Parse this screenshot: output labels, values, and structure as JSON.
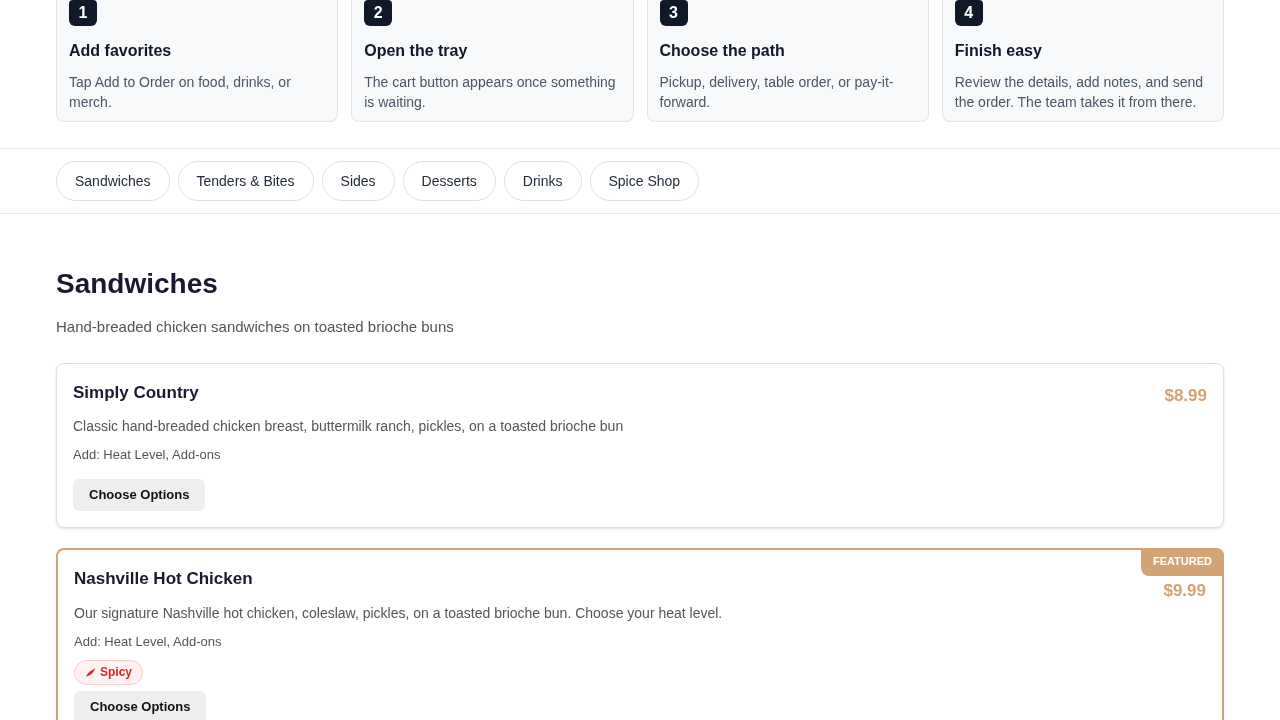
{
  "steps": [
    {
      "number": "1",
      "title": "Add favorites",
      "text": "Tap Add to Order on food, drinks, or merch."
    },
    {
      "number": "2",
      "title": "Open the tray",
      "text": "The cart button appears once something is waiting."
    },
    {
      "number": "3",
      "title": "Choose the path",
      "text": "Pickup, delivery, table order, or pay-it-forward."
    },
    {
      "number": "4",
      "title": "Finish easy",
      "text": "Review the details, add notes, and send the order. The team takes it from there."
    }
  ],
  "categories": [
    {
      "label": "Sandwiches"
    },
    {
      "label": "Tenders & Bites"
    },
    {
      "label": "Sides"
    },
    {
      "label": "Desserts"
    },
    {
      "label": "Drinks"
    },
    {
      "label": "Spice Shop"
    }
  ],
  "section": {
    "title": "Sandwiches",
    "subtitle": "Hand-breaded chicken sandwiches on toasted brioche buns"
  },
  "items": [
    {
      "name": "Simply Country",
      "price": "$8.99",
      "description": "Classic hand-breaded chicken breast, buttermilk ranch, pickles, on a toasted brioche bun",
      "addons": "Add: Heat Level, Add-ons",
      "featured": false,
      "button": "Choose Options"
    },
    {
      "name": "Nashville Hot Chicken",
      "price": "$9.99",
      "description": "Our signature Nashville hot chicken, coleslaw, pickles, on a toasted brioche bun. Choose your heat level.",
      "addons": "Add: Heat Level, Add-ons",
      "featured": true,
      "badge": "FEATURED",
      "tags": [
        "Spicy"
      ],
      "button": "Choose Options"
    }
  ]
}
